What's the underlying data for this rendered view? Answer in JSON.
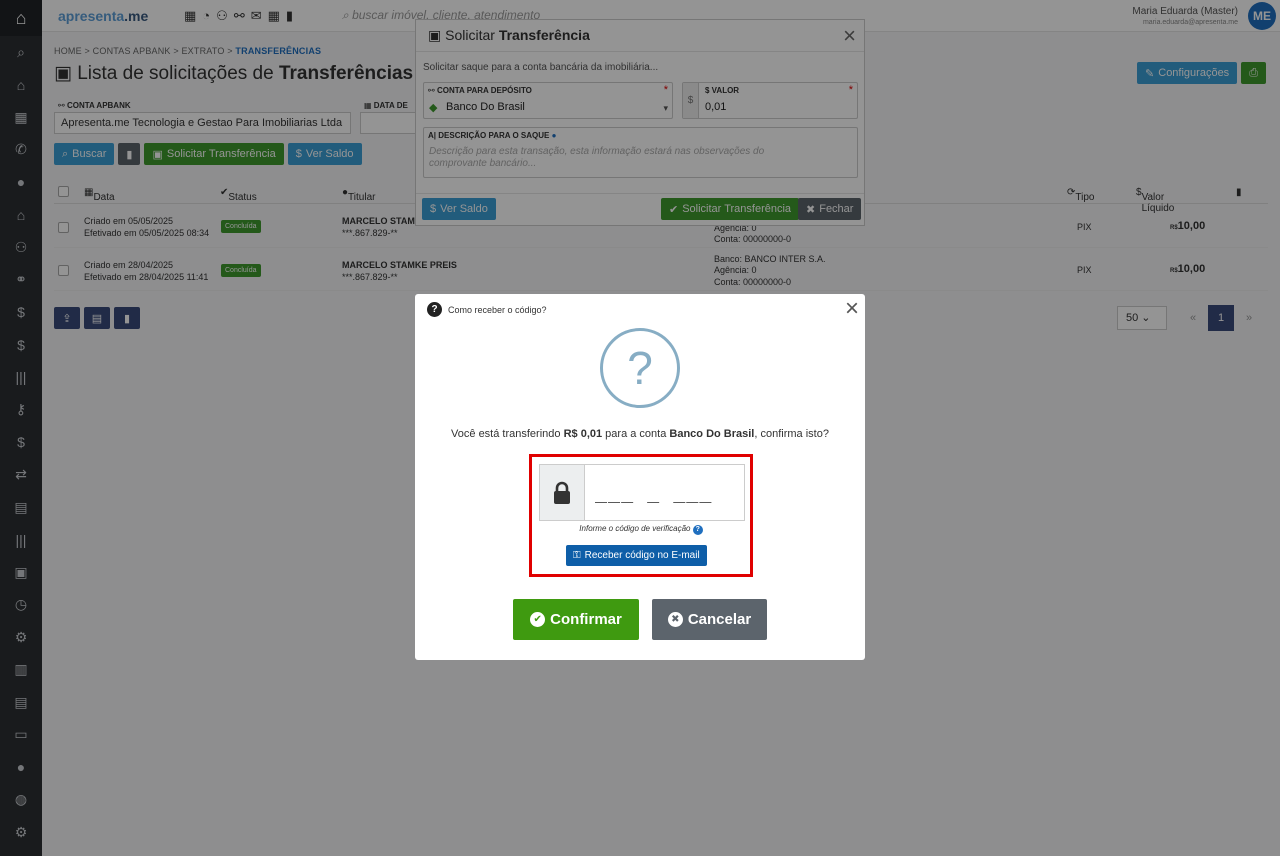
{
  "brand": {
    "name_part1": "apresenta",
    "name_part2": ".me"
  },
  "topbar": {
    "search_placeholder": "buscar imóvel, cliente, atendimento",
    "user_name": "Maria Eduarda (Master)",
    "user_email": "maria.eduarda@apresenta.me",
    "avatar": "ME"
  },
  "breadcrumb": {
    "items": [
      "HOME",
      "CONTAS APBANK",
      "EXTRATO"
    ],
    "current": "TRANSFERÊNCIAS"
  },
  "page": {
    "title_prefix": "Lista de solicitações de",
    "title_bold": "Transferências",
    "config_button": "Configurações"
  },
  "filters": {
    "conta_label": "CONTA APBANK",
    "conta_value": "Apresenta.me Tecnologia e Gestao Para Imobiliarias Ltda",
    "data_label": "DATA DE",
    "buscar": "Buscar",
    "solicitar": "Solicitar Transferência",
    "ver_saldo": "Ver Saldo"
  },
  "table": {
    "headers": {
      "data": "Data",
      "status": "Status",
      "titular": "Titular",
      "tipo": "Tipo",
      "valor": "Valor Líquido"
    },
    "rows": [
      {
        "criado": "Criado em 05/05/2025",
        "efetivado": "Efetivado em 05/05/2025 08:34",
        "status": "Concluída",
        "titular": "MARCELO STAM",
        "doc": "***.867.829-**",
        "banco": "",
        "agencia": "Agência: 0",
        "conta": "Conta: 00000000-0",
        "tipo": "PIX",
        "moeda": "R$",
        "valor": "10,00"
      },
      {
        "criado": "Criado em 28/04/2025",
        "efetivado": "Efetivado em 28/04/2025 11:41",
        "status": "Concluída",
        "titular": "MARCELO STAMKE PREIS",
        "doc": "***.867.829-**",
        "banco": "Banco: BANCO INTER S.A.",
        "agencia": "Agência: 0",
        "conta": "Conta: 00000000-0",
        "tipo": "PIX",
        "moeda": "R$",
        "valor": "10,00"
      }
    ]
  },
  "pagination": {
    "per_page": "50",
    "current": "1"
  },
  "modal_transfer": {
    "title_prefix": "Solicitar",
    "title_bold": "Transferência",
    "subtitle": "Solicitar saque para a conta bancária da imobiliária...",
    "conta_label": "CONTA PARA DEPÓSITO",
    "conta_value": "Banco Do Brasil",
    "valor_label": "VALOR",
    "valor_value": "0,01",
    "currency_symbol": "$",
    "required_mark": "*",
    "desc_label": "DESCRIÇÃO PARA O SAQUE",
    "desc_placeholder": "Descrição para esta transação, esta informação estará nas observações do comprovante bancário...",
    "ver_saldo": "Ver Saldo",
    "solicitar": "Solicitar Transferência",
    "fechar": "Fechar"
  },
  "modal_confirm": {
    "header": "Como receber o código?",
    "text_1": "Você está transferindo",
    "amount": "R$ 0,01",
    "text_2": "para a conta",
    "bank": "Banco Do Brasil",
    "text_3": ", confirma isto?",
    "code_value": "___ _ ___",
    "code_hint": "Informe o código de verificação",
    "email_button": "Receber código no E-mail",
    "confirm": "Confirmar",
    "cancel": "Cancelar"
  },
  "colors": {
    "accent_blue": "#3b9fd6",
    "success_green": "#3f9a2e",
    "highlight_red": "#e00000",
    "sidebar": "#2b2f33"
  }
}
